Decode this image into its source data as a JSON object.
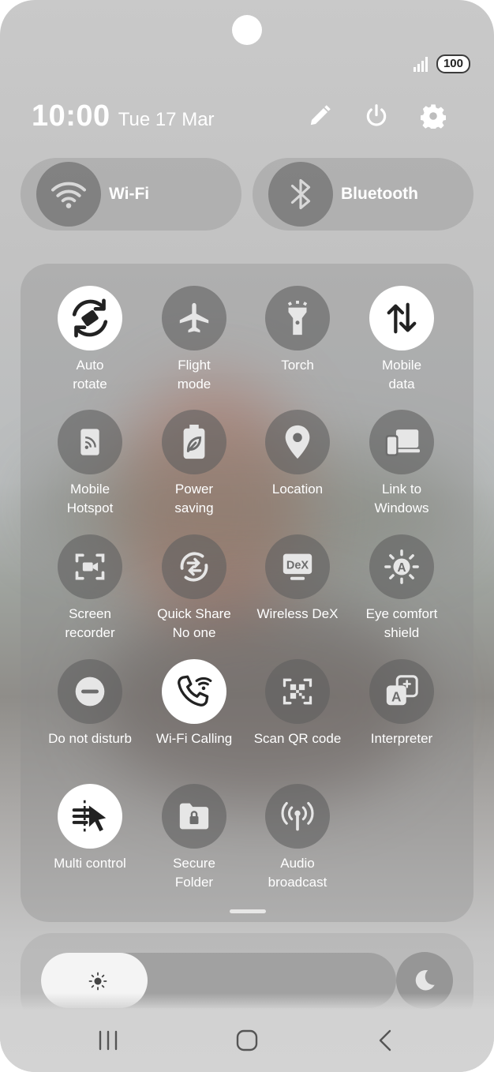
{
  "status": {
    "battery": "100"
  },
  "header": {
    "time": "10:00",
    "date": "Tue 17 Mar"
  },
  "big_tiles": {
    "wifi": "Wi-Fi",
    "bluetooth": "Bluetooth"
  },
  "tiles": [
    {
      "line1": "Auto",
      "line2": "rotate",
      "icon": "auto-rotate-icon",
      "on": true
    },
    {
      "line1": "Flight",
      "line2": "mode",
      "icon": "airplane-icon",
      "on": false
    },
    {
      "line1": "Torch",
      "line2": "",
      "icon": "torch-icon",
      "on": false
    },
    {
      "line1": "Mobile",
      "line2": "data",
      "icon": "mobile-data-icon",
      "on": true
    },
    {
      "line1": "Mobile",
      "line2": "Hotspot",
      "icon": "hotspot-icon",
      "on": false
    },
    {
      "line1": "Power",
      "line2": "saving",
      "icon": "battery-leaf-icon",
      "on": false
    },
    {
      "line1": "Location",
      "line2": "",
      "icon": "location-pin-icon",
      "on": false
    },
    {
      "line1": "Link to",
      "line2": "Windows",
      "icon": "link-windows-icon",
      "on": false
    },
    {
      "line1": "Screen",
      "line2": "recorder",
      "icon": "screen-recorder-icon",
      "on": false
    },
    {
      "line1": "Quick Share",
      "line2": "No one",
      "icon": "quick-share-icon",
      "on": false
    },
    {
      "line1": "Wireless DeX",
      "line2": "",
      "icon": "dex-icon",
      "on": false
    },
    {
      "line1": "Eye comfort",
      "line2": "shield",
      "icon": "eye-comfort-icon",
      "on": false
    },
    {
      "line1": "Do not disturb",
      "line2": "",
      "icon": "do-not-disturb-icon",
      "on": false
    },
    {
      "line1": "Wi-Fi Calling",
      "line2": "",
      "icon": "wifi-calling-icon",
      "on": true
    },
    {
      "line1": "Scan QR code",
      "line2": "",
      "icon": "qr-code-icon",
      "on": false
    },
    {
      "line1": "Interpreter",
      "line2": "",
      "icon": "interpreter-icon",
      "on": false
    },
    {
      "line1": "Multi control",
      "line2": "",
      "icon": "multi-control-icon",
      "on": true
    },
    {
      "line1": "Secure",
      "line2": "Folder",
      "icon": "secure-folder-icon",
      "on": false
    },
    {
      "line1": "Audio",
      "line2": "broadcast",
      "icon": "audio-broadcast-icon",
      "on": false
    }
  ],
  "brightness": {
    "level": 0.3
  }
}
